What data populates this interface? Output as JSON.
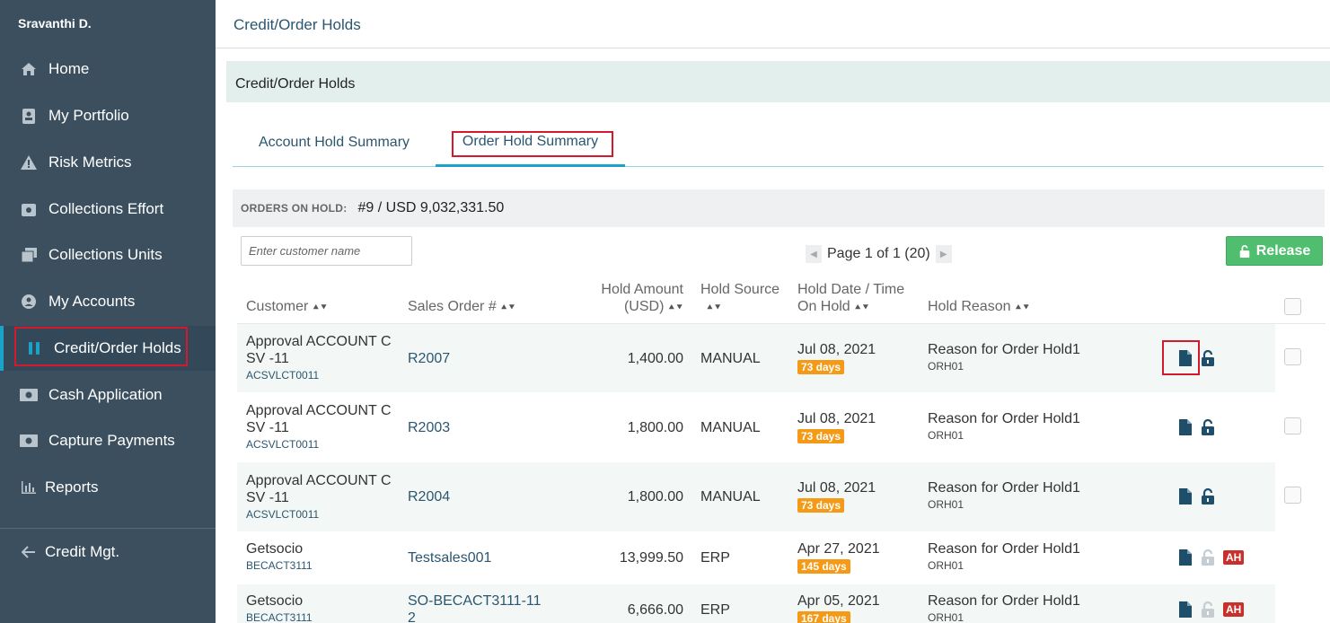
{
  "sidebar": {
    "user": "Sravanthi D.",
    "items": [
      {
        "label": "Home",
        "icon": "home-icon"
      },
      {
        "label": "My Portfolio",
        "icon": "portfolio-icon"
      },
      {
        "label": "Risk Metrics",
        "icon": "warning-icon"
      },
      {
        "label": "Collections Effort",
        "icon": "effort-icon"
      },
      {
        "label": "Collections Units",
        "icon": "units-icon"
      },
      {
        "label": "My Accounts",
        "icon": "user-circle-icon"
      },
      {
        "label": "Credit/Order Holds",
        "icon": "pause-icon"
      },
      {
        "label": "Cash Application",
        "icon": "cash-icon"
      },
      {
        "label": "Capture Payments",
        "icon": "money-icon"
      },
      {
        "label": "Reports",
        "icon": "bar-chart-icon"
      }
    ],
    "back": {
      "label": "Credit Mgt.",
      "icon": "arrow-left-icon"
    }
  },
  "header": {
    "title": "Credit/Order Holds"
  },
  "panel": {
    "title": "Credit/Order Holds"
  },
  "tabs": [
    {
      "label": "Account Hold Summary",
      "active": false
    },
    {
      "label": "Order Hold Summary",
      "active": true
    }
  ],
  "summary": {
    "label": "ORDERS ON HOLD:",
    "value": "#9 / USD 9,032,331.50"
  },
  "search": {
    "placeholder": "Enter customer name"
  },
  "pager": {
    "text": "Page 1 of 1 (20)"
  },
  "release": {
    "label": "Release"
  },
  "columns": {
    "customer": "Customer",
    "sales_order": "Sales Order #",
    "hold_amount_1": "Hold Amount",
    "hold_amount_2": "(USD)",
    "hold_source_1": "Hold Source",
    "hold_date_1": "Hold Date / Time",
    "hold_date_2": "On Hold",
    "hold_reason": "Hold Reason"
  },
  "rows": [
    {
      "name1": "Approval ACCOUNT C",
      "name2": "SV -11",
      "account": "ACSVLCT0011",
      "so1": "R2007",
      "so2": "",
      "amount": "1,400.00",
      "source": "MANUAL",
      "date": "Jul 08, 2021",
      "days": "73 days",
      "reason": "Reason for Order Hold1",
      "code": "ORH01",
      "ah": ""
    },
    {
      "name1": "Approval ACCOUNT C",
      "name2": "SV -11",
      "account": "ACSVLCT0011",
      "so1": "R2003",
      "so2": "",
      "amount": "1,800.00",
      "source": "MANUAL",
      "date": "Jul 08, 2021",
      "days": "73 days",
      "reason": "Reason for Order Hold1",
      "code": "ORH01",
      "ah": ""
    },
    {
      "name1": "Approval ACCOUNT C",
      "name2": "SV -11",
      "account": "ACSVLCT0011",
      "so1": "R2004",
      "so2": "",
      "amount": "1,800.00",
      "source": "MANUAL",
      "date": "Jul 08, 2021",
      "days": "73 days",
      "reason": "Reason for Order Hold1",
      "code": "ORH01",
      "ah": ""
    },
    {
      "name1": "Getsocio",
      "name2": "",
      "account": "BECACT3111",
      "so1": "Testsales001",
      "so2": "",
      "amount": "13,999.50",
      "source": "ERP",
      "date": "Apr 27, 2021",
      "days": "145 days",
      "reason": "Reason for Order Hold1",
      "code": "ORH01",
      "ah": "AH"
    },
    {
      "name1": "Getsocio",
      "name2": "",
      "account": "BECACT3111",
      "so1": "SO-BECACT3111-11",
      "so2": "2",
      "amount": "6,666.00",
      "source": "ERP",
      "date": "Apr 05, 2021",
      "days": "167 days",
      "reason": "Reason for Order Hold1",
      "code": "ORH01",
      "ah": "AH"
    }
  ],
  "colors": {
    "sidebar": "#3b4f5e",
    "accent": "#1aa3c9",
    "link": "#2b5670",
    "badge": "#f49a17",
    "release": "#4fbf6f",
    "ah": "#c9302c",
    "highlight": "#d6182c"
  }
}
